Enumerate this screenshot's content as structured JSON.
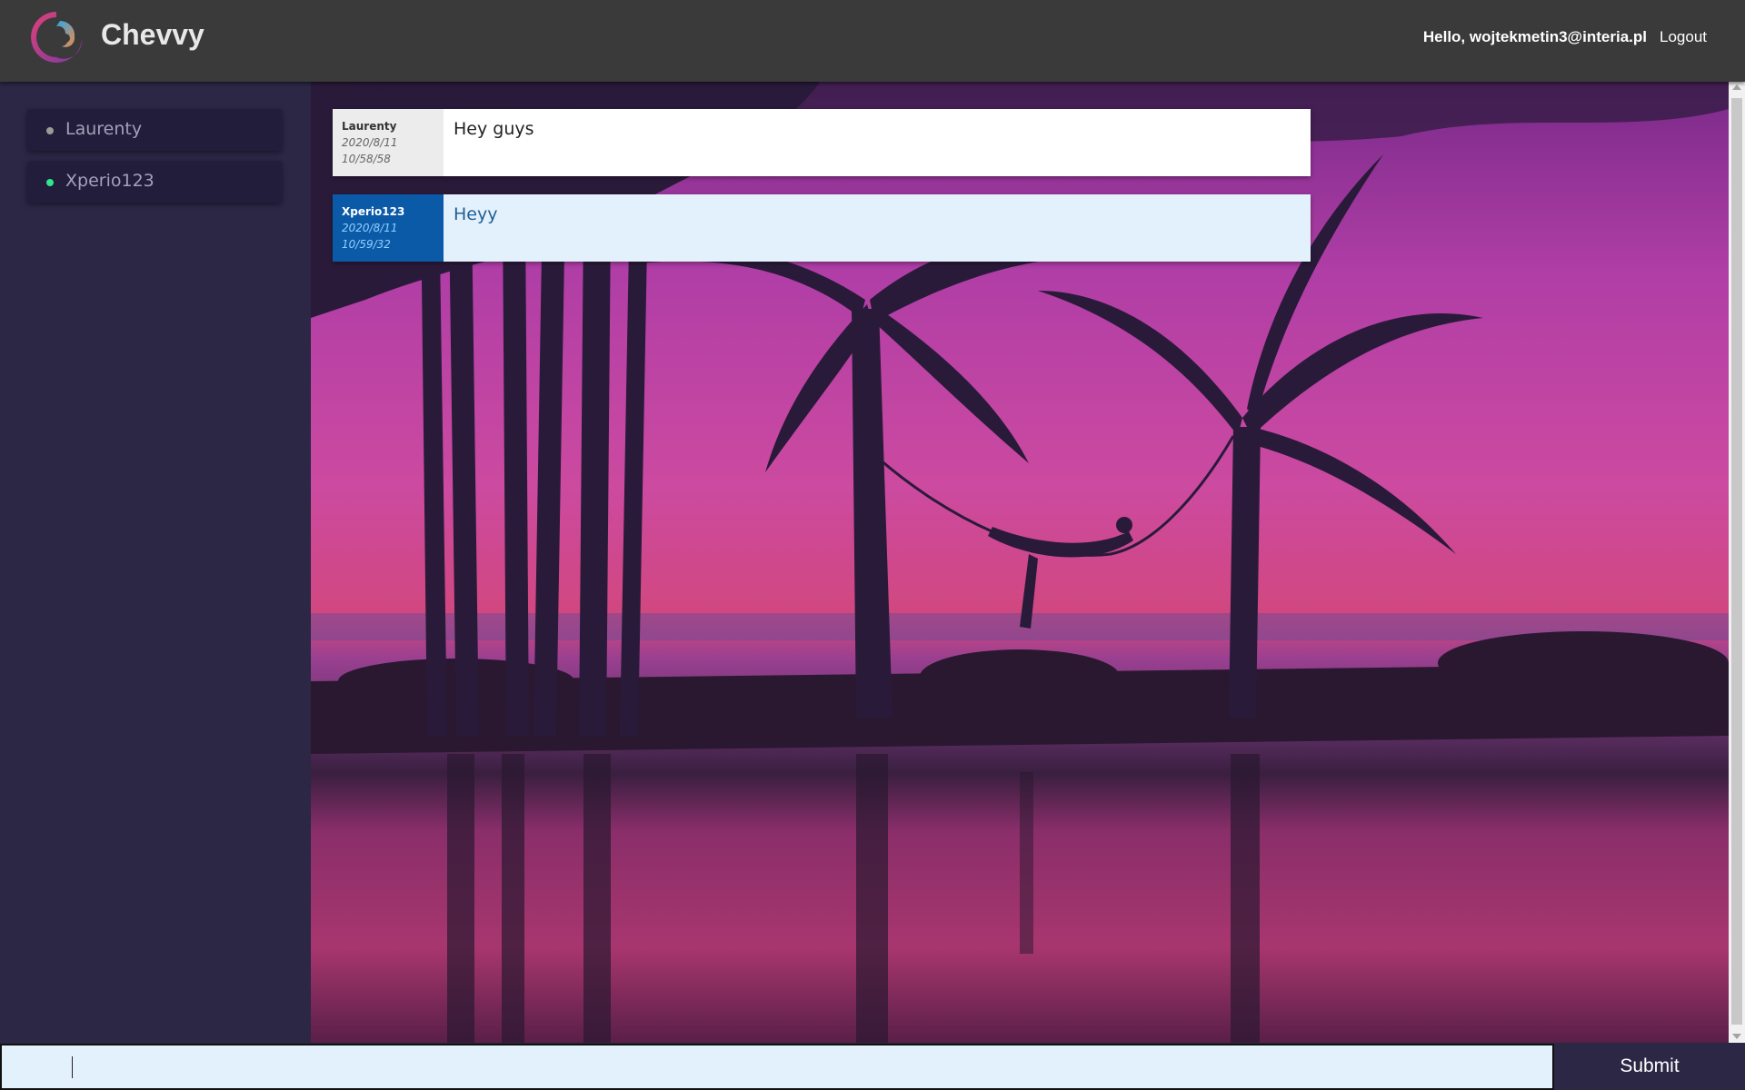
{
  "header": {
    "brand": "Chevvy",
    "greeting": "Hello, wojtekmetin3@interia.pl",
    "logout_label": "Logout",
    "logo_icon": "swirl-logo-icon"
  },
  "sidebar": {
    "users": [
      {
        "name": "Laurenty",
        "status": "offline",
        "status_color": "#9a9a9a"
      },
      {
        "name": "Xperio123",
        "status": "online",
        "status_color": "#2ee88a"
      }
    ]
  },
  "messages": [
    {
      "author": "Laurenty",
      "date": "2020/8/11",
      "time": "10/58/58",
      "text": "Hey guys",
      "own": false
    },
    {
      "author": "Xperio123",
      "date": "2020/8/11",
      "time": "10/59/32",
      "text": "Heyy",
      "own": true
    }
  ],
  "composer": {
    "value": "",
    "placeholder": "",
    "submit_label": "Submit"
  },
  "colors": {
    "header_bg": "#3a3a3a",
    "sidebar_bg": "#2b2745",
    "own_meta_bg": "#0b5aa8",
    "own_body_bg": "#e3f1fc"
  }
}
